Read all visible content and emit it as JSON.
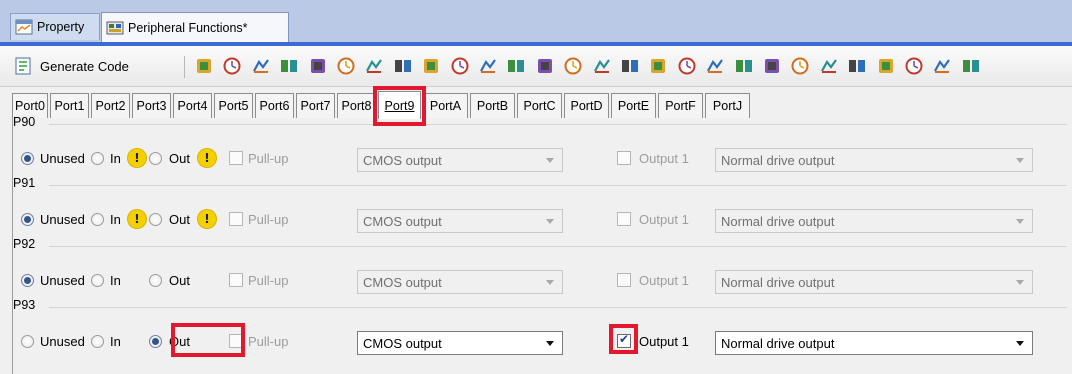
{
  "document_tabs": [
    {
      "label": "Property",
      "active": false
    },
    {
      "label": "Peripheral Functions*",
      "active": true
    }
  ],
  "toolbar": {
    "generate_code_label": "Generate Code",
    "icons": [
      "pin-config-icon",
      "port-icon",
      "clock-icon",
      "timer-icon",
      "interrupt-icon",
      "chip-icon",
      "dma-icon",
      "dtc-icon",
      "link-icon",
      "bus-icon",
      "timer-a-icon",
      "timer-b-icon",
      "timer-c-icon",
      "timer-d-icon",
      "timer-e-icon",
      "timer-f-icon",
      "timer-g-icon",
      "calendar-icon",
      "sci-icon",
      "sci2-icon",
      "iic-icon",
      "grid-icon",
      "spi-icon",
      "adc-icon",
      "signal-icon",
      "dac-icon",
      "counter-icon",
      "sort-icon"
    ]
  },
  "port_tabs": [
    "Port0",
    "Port1",
    "Port2",
    "Port3",
    "Port4",
    "Port5",
    "Port6",
    "Port7",
    "Port8",
    "Port9",
    "PortA",
    "PortB",
    "PortC",
    "PortD",
    "PortE",
    "PortF",
    "PortJ"
  ],
  "active_port": "Port9",
  "labels": {
    "unused": "Unused",
    "in": "In",
    "out": "Out",
    "pullup": "Pull-up",
    "output1": "Output 1",
    "warn_symbol": "!"
  },
  "pins": [
    {
      "name": "P90",
      "mode": "Unused",
      "warn": true,
      "pullup": false,
      "output_type": "CMOS output",
      "output1": false,
      "drive": "Normal drive output",
      "enabled": false
    },
    {
      "name": "P91",
      "mode": "Unused",
      "warn": true,
      "pullup": false,
      "output_type": "CMOS output",
      "output1": false,
      "drive": "Normal drive output",
      "enabled": false
    },
    {
      "name": "P92",
      "mode": "Unused",
      "warn": false,
      "pullup": false,
      "output_type": "CMOS output",
      "output1": false,
      "drive": "Normal drive output",
      "enabled": false
    },
    {
      "name": "P93",
      "mode": "Out",
      "warn": false,
      "pullup": false,
      "output_type": "CMOS output",
      "output1": true,
      "drive": "Normal drive output",
      "enabled": true
    }
  ],
  "colors": {
    "highlight": "#e2182c",
    "accent": "#3c6bd6"
  }
}
